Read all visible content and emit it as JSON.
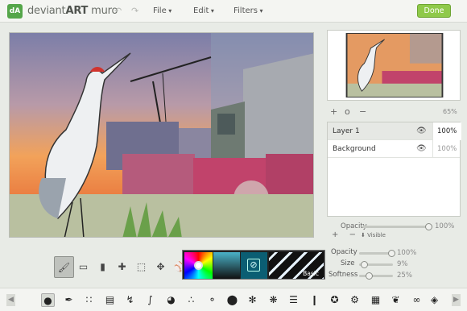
{
  "app": {
    "logo": "dA",
    "name_prefix": "deviant",
    "name_bold": "ART",
    "name_suffix": " muro",
    "undo_icon": "undo-icon",
    "redo_icon": "redo-icon"
  },
  "menus": [
    "File",
    "Edit",
    "Filters"
  ],
  "done_label": "Done",
  "navigator": {
    "zoom_in": "+",
    "zoom_reset": "o",
    "zoom_out": "−",
    "zoom": "65%"
  },
  "layers": [
    {
      "name": "Layer 1",
      "opacity": "100%",
      "active": true
    },
    {
      "name": "Background",
      "opacity": "100%",
      "active": false
    }
  ],
  "layer_opacity": {
    "label": "Opacity",
    "value": "100%",
    "level": 1.0
  },
  "layer_actions": {
    "add": "+",
    "remove": "−",
    "visible": "Visible"
  },
  "tools": [
    "brush-tool",
    "eraser-tool",
    "smudge-tool",
    "eyedropper-tool",
    "select-tool",
    "move-tool",
    "lasso-tool"
  ],
  "palette": {
    "basic_label": "Basic",
    "current_color": "#0b5e73"
  },
  "brush_settings": [
    {
      "label": "Opacity",
      "value": "100%",
      "level": 1.0
    },
    {
      "label": "Size",
      "value": "9%",
      "level": 0.09
    },
    {
      "label": "Softness",
      "value": "25%",
      "level": 0.25
    }
  ],
  "brushes": [
    "round-brush",
    "ink-brush",
    "stipple-brush",
    "hatch-brush",
    "line-brush",
    "scribble-brush",
    "pie-brush",
    "spray-brush",
    "bubble-brush",
    "drip-brush",
    "splat-brush",
    "grass-brush",
    "hair-brush",
    "column-brush",
    "knot-brush",
    "wheel-brush",
    "mesh-brush",
    "leaf-brush",
    "swirl-brush",
    "drop-brush"
  ],
  "colors": {
    "accent": "#8fc94a",
    "background": "#e8ebe6"
  }
}
